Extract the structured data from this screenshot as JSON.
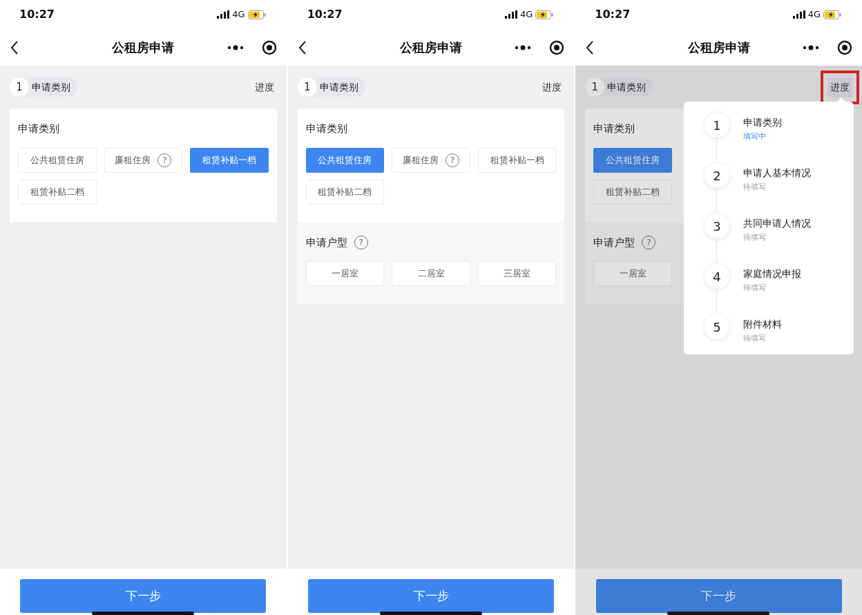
{
  "phones": [
    {
      "status_bar": {
        "time": "10:27",
        "network": "4G"
      },
      "nav": {
        "title": "公租房申请"
      },
      "step": {
        "number": "1",
        "label": "申请类别"
      },
      "progress_link": {
        "label": "进度",
        "highlighted": false
      },
      "sections": [
        {
          "title": "申请类别",
          "options": [
            {
              "label": "公共租赁住房",
              "selected": false
            },
            {
              "label": "廉租住房",
              "help": "?",
              "selected": false
            },
            {
              "label": "租赁补贴一档",
              "selected": true
            },
            {
              "label": "租赁补贴二档",
              "selected": false
            }
          ]
        }
      ],
      "next_button": "下一步"
    },
    {
      "status_bar": {
        "time": "10:27",
        "network": "4G"
      },
      "nav": {
        "title": "公租房申请"
      },
      "step": {
        "number": "1",
        "label": "申请类别"
      },
      "progress_link": {
        "label": "进度",
        "highlighted": false
      },
      "sections": [
        {
          "title": "申请类别",
          "options": [
            {
              "label": "公共租赁住房",
              "selected": true
            },
            {
              "label": "廉租住房",
              "help": "?",
              "selected": false
            },
            {
              "label": "租赁补贴一档",
              "selected": false
            },
            {
              "label": "租赁补贴二档",
              "selected": false
            }
          ]
        },
        {
          "title": "申请户型",
          "help": "?",
          "options": [
            {
              "label": "一居室",
              "selected": false
            },
            {
              "label": "二居室",
              "selected": false
            },
            {
              "label": "三居室",
              "selected": false
            }
          ]
        }
      ],
      "next_button": "下一步"
    },
    {
      "status_bar": {
        "time": "10:27",
        "network": "4G"
      },
      "nav": {
        "title": "公租房申请"
      },
      "step": {
        "number": "1",
        "label": "申请类别"
      },
      "progress_link": {
        "label": "进度",
        "highlighted": true
      },
      "sections": [
        {
          "title": "申请类别",
          "options": [
            {
              "label": "公共租赁住房",
              "selected": true
            },
            {
              "label": "租赁补贴二档",
              "selected": false,
              "new_row": true
            }
          ]
        },
        {
          "title": "申请户型",
          "help": "?",
          "options": [
            {
              "label": "一居室",
              "selected": false
            }
          ]
        }
      ],
      "next_button": "下一步",
      "progress_popup": {
        "steps": [
          {
            "number": "1",
            "title": "申请类别",
            "status": "填写中",
            "current": true
          },
          {
            "number": "2",
            "title": "申请人基本情况",
            "status": "待填写",
            "current": false
          },
          {
            "number": "3",
            "title": "共同申请人情况",
            "status": "待填写",
            "current": false
          },
          {
            "number": "4",
            "title": "家庭情况申报",
            "status": "待填写",
            "current": false
          },
          {
            "number": "5",
            "title": "附件材料",
            "status": "待填写",
            "current": false
          }
        ]
      }
    }
  ]
}
